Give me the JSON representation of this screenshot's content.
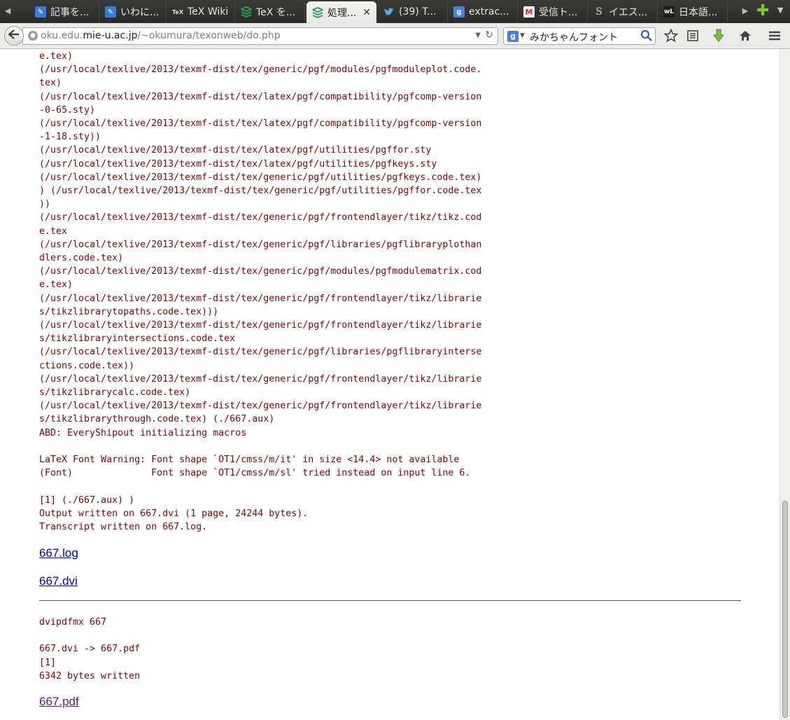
{
  "tabs": [
    {
      "label": "記事を...",
      "icon": "edit-icon",
      "active": false
    },
    {
      "label": "いわに...",
      "icon": "edit-icon",
      "active": false
    },
    {
      "label": "TeX Wiki",
      "icon": "tex-icon",
      "active": false
    },
    {
      "label": "TeX を...",
      "icon": "stack-icon",
      "active": false
    },
    {
      "label": "処理...",
      "icon": "stack-icon",
      "active": true
    },
    {
      "label": "(39) T...",
      "icon": "twitter-icon",
      "active": false
    },
    {
      "label": "extrac...",
      "icon": "google-icon",
      "active": false
    },
    {
      "label": "受信ト...",
      "icon": "gmail-icon",
      "active": false
    },
    {
      "label": "イエス...",
      "icon": "s-icon",
      "active": false
    },
    {
      "label": "日本語...",
      "icon": "wl-icon",
      "active": false
    }
  ],
  "favicon_text": {
    "tex": "TeX",
    "google": "g",
    "gmail": "M",
    "s": "S",
    "wl": "wL"
  },
  "address": {
    "prefix": "oku.edu.",
    "domain": "mie-u.ac.jp",
    "path": "/~okumura/texonweb/do.php"
  },
  "search": {
    "engine": "g",
    "value": "みかちゃんフォント"
  },
  "log_text": "e.tex)\n(/usr/local/texlive/2013/texmf-dist/tex/generic/pgf/modules/pgfmoduleplot.code.\ntex)\n(/usr/local/texlive/2013/texmf-dist/tex/latex/pgf/compatibility/pgfcomp-version\n-0-65.sty)\n(/usr/local/texlive/2013/texmf-dist/tex/latex/pgf/compatibility/pgfcomp-version\n-1-18.sty))\n(/usr/local/texlive/2013/texmf-dist/tex/latex/pgf/utilities/pgffor.sty\n(/usr/local/texlive/2013/texmf-dist/tex/latex/pgf/utilities/pgfkeys.sty\n(/usr/local/texlive/2013/texmf-dist/tex/generic/pgf/utilities/pgfkeys.code.tex)\n) (/usr/local/texlive/2013/texmf-dist/tex/generic/pgf/utilities/pgffor.code.tex\n))\n(/usr/local/texlive/2013/texmf-dist/tex/generic/pgf/frontendlayer/tikz/tikz.cod\ne.tex\n(/usr/local/texlive/2013/texmf-dist/tex/generic/pgf/libraries/pgflibraryplothan\ndlers.code.tex)\n(/usr/local/texlive/2013/texmf-dist/tex/generic/pgf/modules/pgfmodulematrix.cod\ne.tex)\n(/usr/local/texlive/2013/texmf-dist/tex/generic/pgf/frontendlayer/tikz/librarie\ns/tikzlibrarytopaths.code.tex)))\n(/usr/local/texlive/2013/texmf-dist/tex/generic/pgf/frontendlayer/tikz/librarie\ns/tikzlibraryintersections.code.tex\n(/usr/local/texlive/2013/texmf-dist/tex/generic/pgf/libraries/pgflibraryinterse\nctions.code.tex))\n(/usr/local/texlive/2013/texmf-dist/tex/generic/pgf/frontendlayer/tikz/librarie\ns/tikzlibrarycalc.code.tex)\n(/usr/local/texlive/2013/texmf-dist/tex/generic/pgf/frontendlayer/tikz/librarie\ns/tikzlibrarythrough.code.tex) (./667.aux)\nABD: EveryShipout initializing macros\n\nLaTeX Font Warning: Font shape `OT1/cmss/m/it' in size <14.4> not available\n(Font)              Font shape `OT1/cmss/m/sl' tried instead on input line 6.\n\n[1] (./667.aux) )\nOutput written on 667.dvi (1 page, 24244 bytes).\nTranscript written on 667.log.",
  "links": {
    "log": "667.log",
    "dvi": "667.dvi",
    "pdf": "667.pdf"
  },
  "dvipdfmx_text": "dvipdfmx 667\n\n667.dvi -> 667.pdf\n[1]\n6342 bytes written",
  "colors": {
    "log_text": "#8b0000",
    "link": "#0000cc",
    "visited_link": "#551a8b"
  }
}
